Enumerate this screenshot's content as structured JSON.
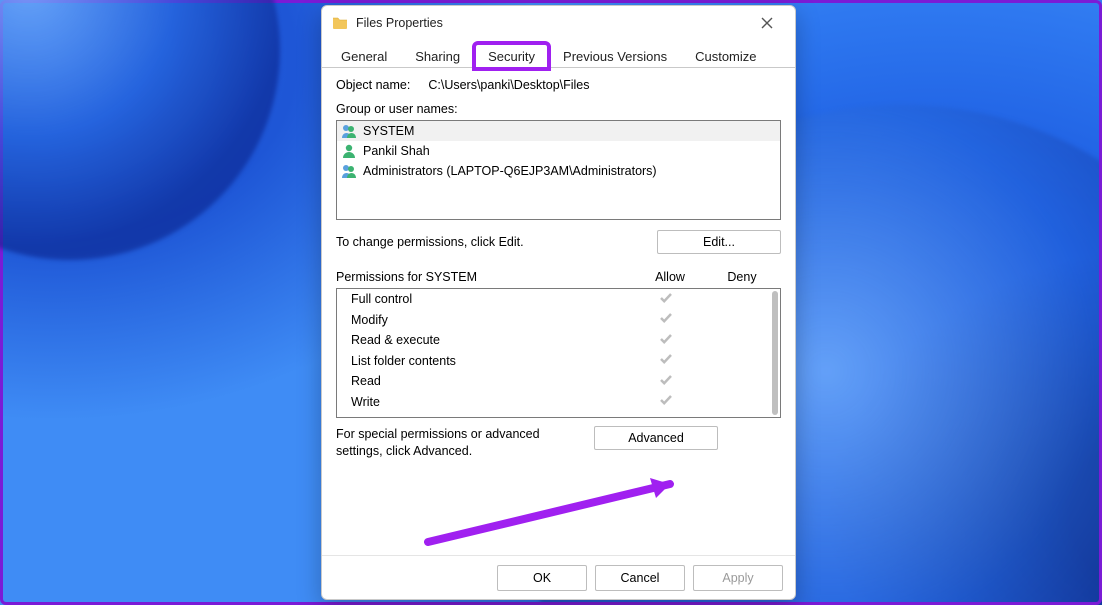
{
  "window": {
    "title": "Files Properties",
    "close_aria": "Close"
  },
  "tabs": {
    "general": "General",
    "sharing": "Sharing",
    "security": "Security",
    "previous": "Previous Versions",
    "customize": "Customize",
    "active": 2,
    "highlight": 2
  },
  "object": {
    "label": "Object name:",
    "value": "C:\\Users\\panki\\Desktop\\Files"
  },
  "groups": {
    "label": "Group or user names:",
    "items": [
      {
        "icon": "group-icon",
        "name": "SYSTEM",
        "selected": true
      },
      {
        "icon": "user-icon",
        "name": "Pankil Shah",
        "selected": false
      },
      {
        "icon": "group-icon",
        "name": "Administrators (LAPTOP-Q6EJP3AM\\Administrators)",
        "selected": false
      }
    ]
  },
  "edit": {
    "hint": "To change permissions, click Edit.",
    "button": "Edit..."
  },
  "perms": {
    "header": "Permissions for SYSTEM",
    "allow": "Allow",
    "deny": "Deny",
    "rows": [
      {
        "name": "Full control",
        "allow": true,
        "deny": false
      },
      {
        "name": "Modify",
        "allow": true,
        "deny": false
      },
      {
        "name": "Read & execute",
        "allow": true,
        "deny": false
      },
      {
        "name": "List folder contents",
        "allow": true,
        "deny": false
      },
      {
        "name": "Read",
        "allow": true,
        "deny": false
      },
      {
        "name": "Write",
        "allow": true,
        "deny": false
      }
    ]
  },
  "advanced": {
    "hint": "For special permissions or advanced settings, click Advanced.",
    "button": "Advanced"
  },
  "footer": {
    "ok": "OK",
    "cancel": "Cancel",
    "apply": "Apply"
  }
}
